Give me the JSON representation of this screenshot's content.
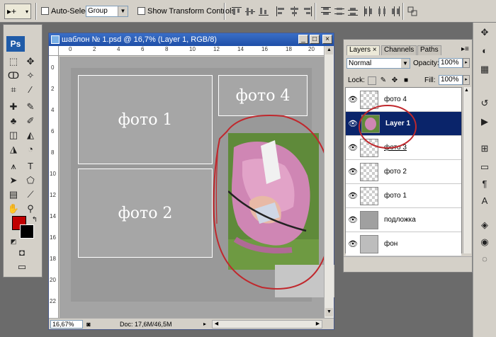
{
  "options_bar": {
    "auto_select_label": "Auto-Select:",
    "auto_select_value": "Group",
    "show_transform_label": "Show Transform Controls",
    "move_tool_glyph": "▸+",
    "align_icons": [
      "align-top-icon",
      "align-vcenter-icon",
      "align-bottom-icon",
      "align-left-icon",
      "align-hcenter-icon",
      "align-right-icon",
      "distribute-top-icon",
      "distribute-vcenter-icon",
      "distribute-bottom-icon",
      "distribute-left-icon",
      "distribute-hcenter-icon",
      "distribute-right-icon",
      "auto-align-icon"
    ]
  },
  "toolbox": {
    "ps_label": "Ps",
    "foreground_color": "#c00000",
    "background_color": "#000000"
  },
  "document": {
    "title": "шаблон № 1.psd @ 16,7% (Layer 1, RGB/8)",
    "zoom": "16,67%",
    "doc_size": "Doc: 17,6M/46,5M",
    "ruler_h": [
      "0",
      "2",
      "4",
      "6",
      "8",
      "10",
      "12",
      "14",
      "16",
      "18",
      "20"
    ],
    "ruler_v": [
      "0",
      "2",
      "4",
      "6",
      "8",
      "10",
      "12",
      "14",
      "16",
      "18",
      "20",
      "22"
    ],
    "slots": {
      "foto1": "фото 1",
      "foto2": "фото 2",
      "foto4": "фото 4"
    },
    "annotation_color": "#c0282d"
  },
  "layers_panel": {
    "tabs": [
      "Layers ×",
      "Channels",
      "Paths"
    ],
    "blend_mode": "Normal",
    "opacity_label": "Opacity:",
    "opacity_value": "100%",
    "lock_label": "Lock:",
    "fill_label": "Fill:",
    "fill_value": "100%",
    "layers": [
      {
        "name": "фото 4",
        "selected": false
      },
      {
        "name": "Layer 1",
        "selected": true
      },
      {
        "name": "фото 3",
        "selected": false
      },
      {
        "name": "фото 2",
        "selected": false
      },
      {
        "name": "фото 1",
        "selected": false
      },
      {
        "name": "подложка",
        "selected": false
      },
      {
        "name": "фон",
        "selected": false
      }
    ]
  }
}
